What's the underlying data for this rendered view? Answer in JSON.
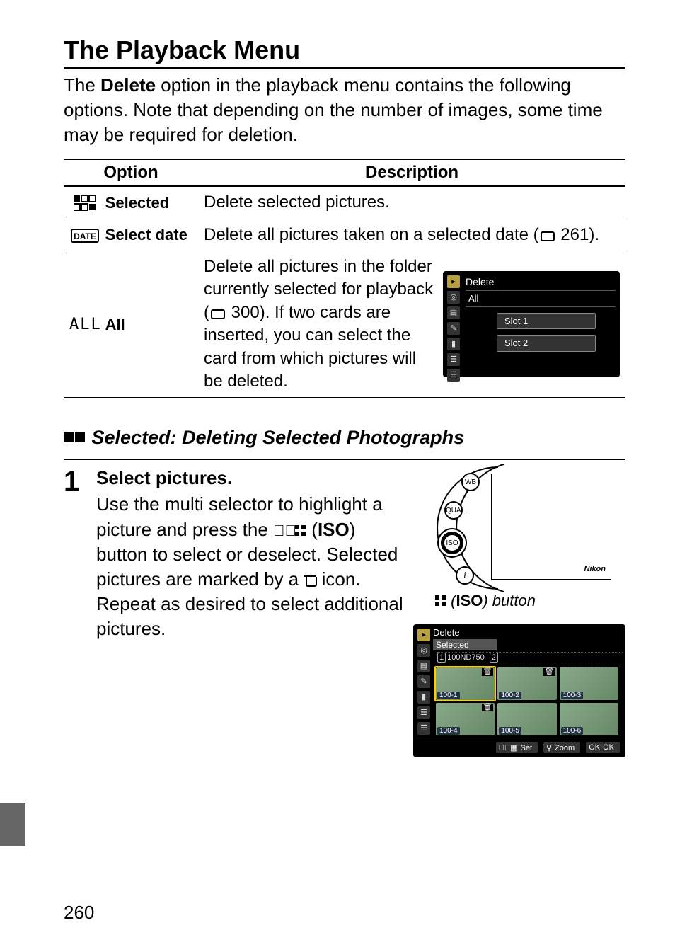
{
  "title": "The Playback Menu",
  "intro": {
    "pre": "The ",
    "bold": "Delete",
    "post": " option in the playback menu contains the following options.  Note that depending on the number of images, some time may be required for deletion."
  },
  "table": {
    "headers": {
      "option": "Option",
      "description": "Description"
    },
    "rows": {
      "selected": {
        "label": "Selected",
        "desc": "Delete selected pictures."
      },
      "select_date": {
        "label": "Select date",
        "desc_pre": "Delete all pictures taken on a selected date (",
        "desc_ref": "261",
        "desc_post": ")."
      },
      "all": {
        "icon_text": "ALL",
        "label": "All",
        "desc_pre": "Delete all pictures in the folder currently selected for playback (",
        "desc_ref": "300",
        "desc_post": ").  If two cards are inserted, you can select the card from which pictures will be deleted.",
        "screen": {
          "title": "Delete",
          "sub": "All",
          "slot1": "Slot 1",
          "slot2": "Slot 2"
        }
      }
    }
  },
  "sub_heading": "Selected: Deleting Selected Photographs",
  "step1": {
    "num": "1",
    "title": "Select pictures.",
    "body_pre": "Use the multi selector to highlight a picture and press the ",
    "body_iso1": "ISO",
    "body_mid": ") button to select or deselect. Selected pictures are marked by a ",
    "body_post": " icon. Repeat as desired to select additional pictures.",
    "caption_iso": "ISO",
    "caption_post": ") button"
  },
  "cam_label": "Nikon",
  "dial_btn1": "WB",
  "dial_btn2": "QUAL",
  "dial_btn3": "ISO",
  "dial_btn4": "i",
  "thumbs_screen": {
    "title": "Delete",
    "sub": "Selected",
    "folder": "100ND750",
    "labels": [
      "100-1",
      "100-2",
      "100-3",
      "100-4",
      "100-5",
      "100-6"
    ],
    "bar_set": "Set",
    "bar_zoom": "Zoom",
    "bar_ok": "OK"
  },
  "page_num": "260"
}
